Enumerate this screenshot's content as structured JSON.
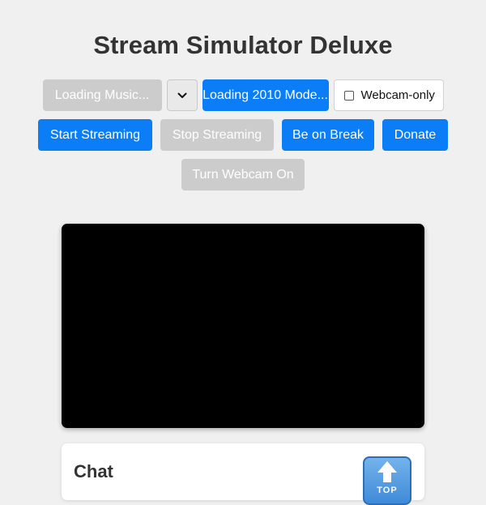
{
  "app": {
    "title": "Stream Simulator Deluxe"
  },
  "controls": {
    "music_button": "Loading Music...",
    "music_select": {
      "selected": ""
    },
    "mode_button": "Loading 2010 Mode...",
    "webcam_only": {
      "label": "Webcam-only",
      "checked": false
    },
    "start_streaming": "Start Streaming",
    "stop_streaming": "Stop Streaming",
    "be_on_break": "Be on Break",
    "donate": "Donate",
    "turn_webcam_on": "Turn Webcam On"
  },
  "chat": {
    "title": "Chat",
    "top_button_label": "TOP"
  },
  "colors": {
    "primary": "#0a7df7",
    "disabled": "#cccccc",
    "background": "#f0f0f0",
    "video": "#000000"
  },
  "icons": {
    "select_arrow": "chevron-down-icon",
    "top_button": "top-arrow-icon"
  }
}
